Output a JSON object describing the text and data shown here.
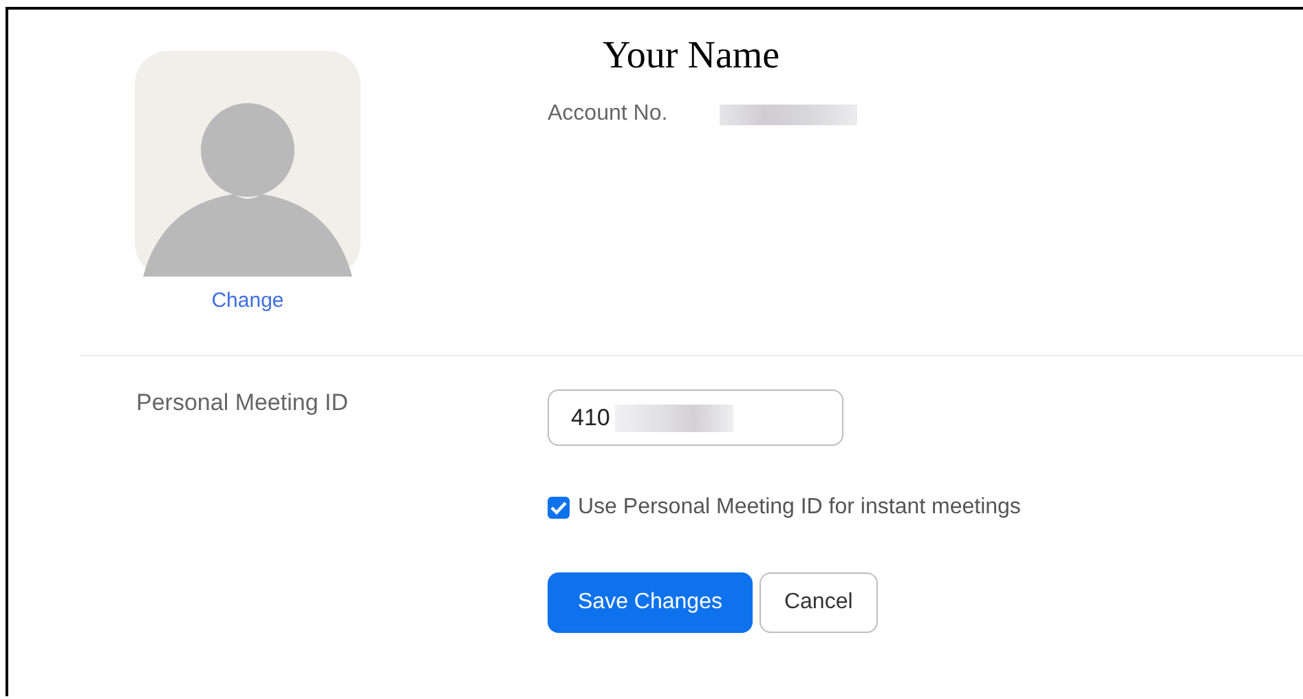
{
  "profile": {
    "name": "Your Name",
    "change_link": "Change",
    "account_label": "Account No."
  },
  "personal_meeting_id": {
    "label": "Personal Meeting ID",
    "value": "410",
    "instant_meetings": {
      "label": "Use Personal Meeting ID for instant meetings",
      "checked": true
    }
  },
  "buttons": [
    {
      "kind": "primary",
      "label": "Save Changes"
    },
    {
      "kind": "secondary",
      "label": "Cancel"
    }
  ]
}
